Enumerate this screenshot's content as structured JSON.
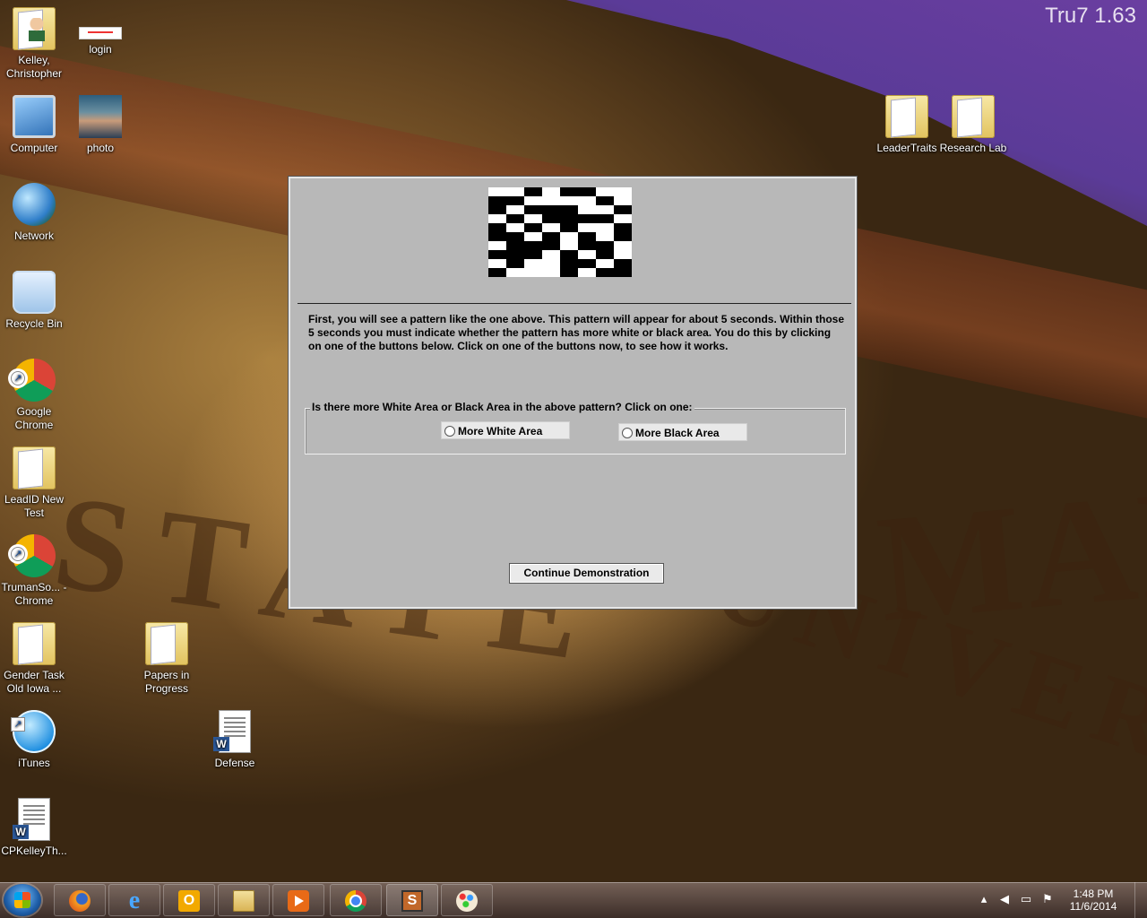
{
  "desktop": {
    "version_label": "Tru7 1.63",
    "icons": [
      {
        "label": "Kelley, Christopher",
        "icon": "user-folder-icon"
      },
      {
        "label": "login",
        "icon": "web-page-thumbnail-icon"
      },
      {
        "label": "Computer",
        "icon": "computer-icon"
      },
      {
        "label": "photo",
        "icon": "photo-thumbnail-icon"
      },
      {
        "label": "Network",
        "icon": "network-globe-icon"
      },
      {
        "label": "Recycle Bin",
        "icon": "recycle-bin-icon"
      },
      {
        "label": "Google Chrome",
        "icon": "chrome-icon"
      },
      {
        "label": "LeadID New Test",
        "icon": "folder-icon"
      },
      {
        "label": "TrumanSo... - Chrome",
        "icon": "chrome-shortcut-icon"
      },
      {
        "label": "Gender Task Old Iowa ...",
        "icon": "folder-icon"
      },
      {
        "label": "Papers in Progress",
        "icon": "folder-icon"
      },
      {
        "label": "iTunes",
        "icon": "itunes-icon"
      },
      {
        "label": "Defense",
        "icon": "word-document-icon"
      },
      {
        "label": "CPKelleyTh...",
        "icon": "word-document-icon"
      },
      {
        "label": "LeaderTraits",
        "icon": "folder-icon"
      },
      {
        "label": "Research Lab",
        "icon": "folder-icon"
      }
    ]
  },
  "dialog": {
    "pattern": [
      "WWBWBBWW",
      "BBWWWWBW",
      "BWBBBWWB",
      "WBWBBBBW",
      "BWBWBWWB",
      "BBWBWBWB",
      "WBBBWBBW",
      "BBBWBWBW",
      "WBWWBBWB",
      "BWWWBWBB"
    ],
    "instructions": "First, you will see a pattern like the one above.  This pattern will appear for about 5 seconds.  Within those 5 seconds you must indicate whether the pattern has more white or black area.  You do this by clicking on one of the buttons below.  Click on one of the buttons now, to see how it works.",
    "question": "Is there more White Area or Black Area in the above pattern?  Click on one:",
    "option_white": "More White Area",
    "option_black": "More Black Area",
    "continue_label": "Continue Demonstration"
  },
  "taskbar": {
    "apps": [
      "firefox-icon",
      "internet-explorer-icon",
      "outlook-icon",
      "file-explorer-icon",
      "media-player-icon",
      "chrome-icon",
      "s-app-icon",
      "paint-icon"
    ],
    "tray_icons": [
      "show-hidden-icons-chevron",
      "volume-icon",
      "network-icon",
      "action-center-flag-icon"
    ],
    "clock_time": "1:48 PM",
    "clock_date": "11/6/2014"
  }
}
